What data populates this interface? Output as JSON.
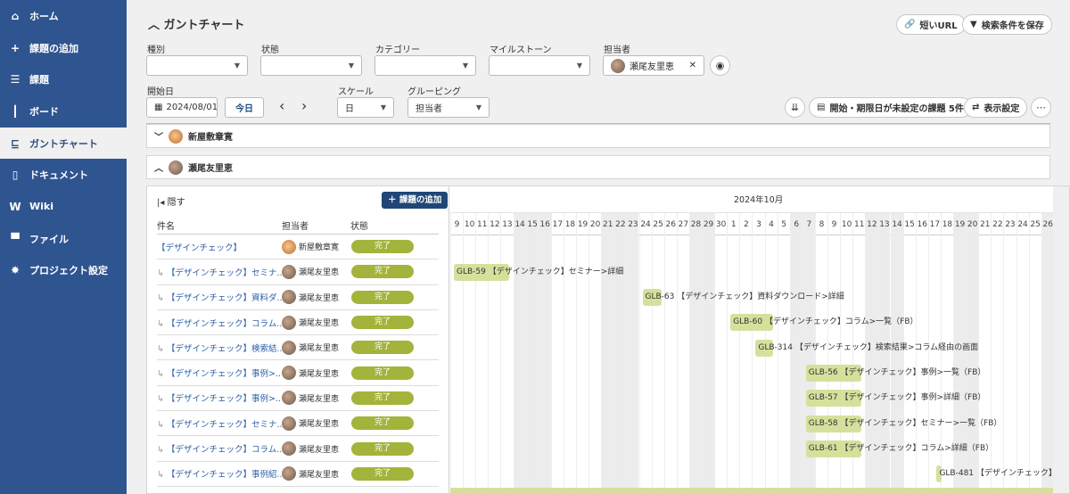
{
  "sidebar": {
    "items": [
      {
        "label": "ホーム",
        "icon": "home-icon",
        "glyph": "⌂"
      },
      {
        "label": "課題の追加",
        "icon": "plus-icon",
        "glyph": "+"
      },
      {
        "label": "課題",
        "icon": "list-icon",
        "glyph": "☰"
      },
      {
        "label": "ボード",
        "icon": "board-icon",
        "glyph": "┃"
      },
      {
        "label": "ガントチャート",
        "icon": "gantt-icon",
        "glyph": "⊑",
        "active": true
      },
      {
        "label": "ドキュメント",
        "icon": "document-icon",
        "glyph": "▯"
      },
      {
        "label": "Wiki",
        "icon": "wiki-icon",
        "glyph": "W"
      },
      {
        "label": "ファイル",
        "icon": "file-icon",
        "glyph": "▀"
      },
      {
        "label": "プロジェクト設定",
        "icon": "gear-icon",
        "glyph": "✸"
      }
    ]
  },
  "header": {
    "title": "ガントチャート",
    "short_url": "短いURL",
    "save_search": "検索条件を保存"
  },
  "filters": {
    "type_label": "種別",
    "status_label": "状態",
    "category_label": "カテゴリー",
    "milestone_label": "マイルストーン",
    "assignee_label": "担当者",
    "assignee_value": "瀬尾友里恵",
    "start_label": "開始日",
    "start_value": "2024/08/01",
    "today": "今日",
    "scale_label": "スケール",
    "scale_value": "日",
    "grouping_label": "グルーピング",
    "grouping_value": "担当者"
  },
  "toolbar": {
    "unscheduled": "開始・期限日が未設定の課題 5件",
    "display_settings": "表示設定"
  },
  "groups": [
    {
      "name": "新屋敷章寛"
    },
    {
      "name": "瀬尾友里恵"
    }
  ],
  "table": {
    "hide": "隠す",
    "add_issue": "課題の追加",
    "col_name": "件名",
    "col_assignee": "担当者",
    "col_status": "状態",
    "rows": [
      {
        "name": "【デザインチェック】",
        "assignee": "新屋敷章寛",
        "status": "完了",
        "child": false
      },
      {
        "name": "【デザインチェック】セミナ...",
        "assignee": "瀬尾友里恵",
        "status": "完了",
        "child": true
      },
      {
        "name": "【デザインチェック】資料ダ...",
        "assignee": "瀬尾友里恵",
        "status": "完了",
        "child": true
      },
      {
        "name": "【デザインチェック】コラム...",
        "assignee": "瀬尾友里恵",
        "status": "完了",
        "child": true
      },
      {
        "name": "【デザインチェック】検索結...",
        "assignee": "瀬尾友里恵",
        "status": "完了",
        "child": true
      },
      {
        "name": "【デザインチェック】事例>...",
        "assignee": "瀬尾友里恵",
        "status": "完了",
        "child": true
      },
      {
        "name": "【デザインチェック】事例>...",
        "assignee": "瀬尾友里恵",
        "status": "完了",
        "child": true
      },
      {
        "name": "【デザインチェック】セミナ...",
        "assignee": "瀬尾友里恵",
        "status": "完了",
        "child": true
      },
      {
        "name": "【デザインチェック】コラム...",
        "assignee": "瀬尾友里恵",
        "status": "完了",
        "child": true
      },
      {
        "name": "【デザインチェック】事例紹...",
        "assignee": "瀬尾友里恵",
        "status": "完了",
        "child": true
      }
    ]
  },
  "timeline": {
    "month": "2024年10月",
    "days": [
      9,
      10,
      11,
      12,
      13,
      14,
      15,
      16,
      17,
      18,
      19,
      20,
      21,
      22,
      23,
      24,
      25,
      26,
      27,
      28,
      29,
      30,
      1,
      2,
      3,
      4,
      5,
      6,
      7,
      8,
      9,
      10,
      11,
      12,
      13,
      14,
      15,
      16,
      17,
      18,
      19,
      20,
      21,
      22,
      23,
      24,
      25,
      26
    ],
    "shaded": [
      5,
      6,
      7,
      12,
      13,
      14,
      19,
      20,
      27,
      28,
      33,
      34,
      35,
      40,
      41,
      47
    ],
    "bars": [
      {
        "row": 1,
        "start": 0,
        "days": 4.4,
        "label": "GLB-59 【デザインチェック】セミナー>詳細"
      },
      {
        "row": 2,
        "start": 15,
        "days": 1.5,
        "label": "GLB-63 【デザインチェック】資料ダウンロード>詳細"
      },
      {
        "row": 3,
        "start": 22,
        "days": 3.4,
        "label": "GLB-60 【デザインチェック】コラム>一覧（FB）"
      },
      {
        "row": 4,
        "start": 24,
        "days": 1.4,
        "label": "GLB-314 【デザインチェック】検索結果>コラム経由の画面"
      },
      {
        "row": 5,
        "start": 28,
        "days": 4.4,
        "label": "GLB-56 【デザインチェック】事例>一覧（FB）"
      },
      {
        "row": 6,
        "start": 28,
        "days": 4.4,
        "label": "GLB-57 【デザインチェック】事例>詳細（FB）"
      },
      {
        "row": 7,
        "start": 28,
        "days": 4.4,
        "label": "GLB-58 【デザインチェック】セミナー>一覧（FB）"
      },
      {
        "row": 8,
        "start": 28,
        "days": 4.4,
        "label": "GLB-61 【デザインチェック】コラム>詳細（FB）"
      },
      {
        "row": 9,
        "start": 38.4,
        "days": 0.4,
        "label": "GLB-481 【デザインチェック】"
      }
    ]
  }
}
